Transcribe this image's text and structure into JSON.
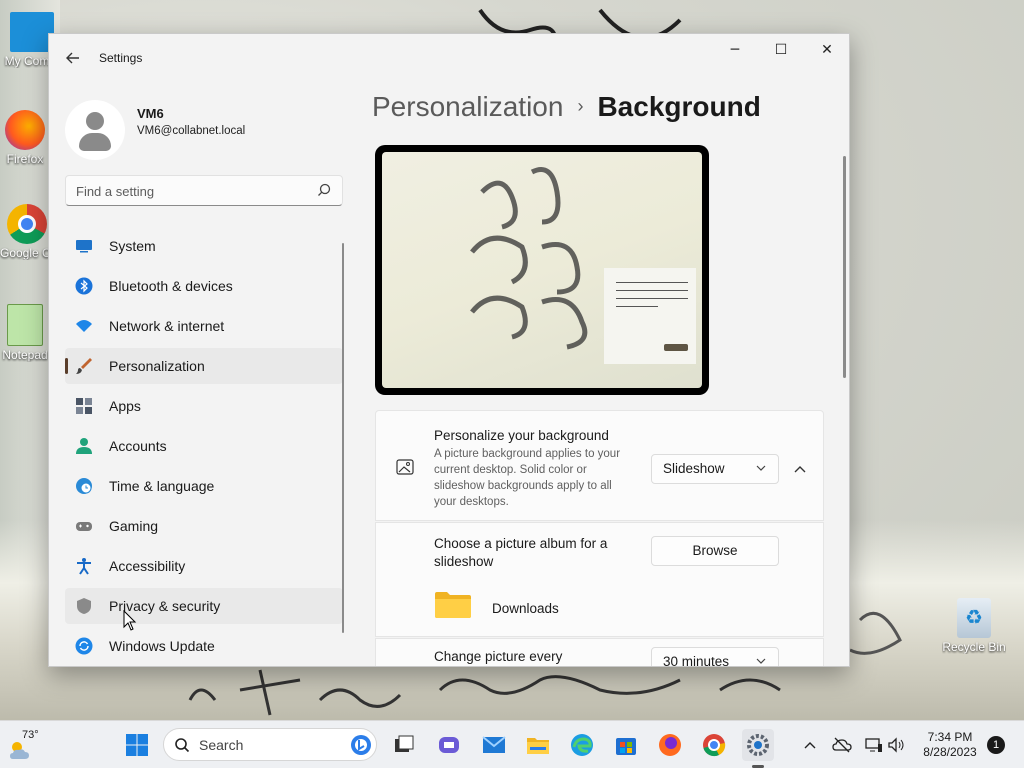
{
  "desktop": {
    "icons": [
      {
        "label": "My Com..."
      },
      {
        "label": "Firefox"
      },
      {
        "label": "Google Chrome"
      },
      {
        "label": "Notepad"
      },
      {
        "label": "Recycle Bin"
      }
    ]
  },
  "window": {
    "app_title": "Settings",
    "controls": {
      "minimize": "─",
      "maximize": "☐",
      "close": "✕"
    }
  },
  "account": {
    "name": "VM6",
    "email": "VM6@collabnet.local"
  },
  "search": {
    "placeholder": "Find a setting"
  },
  "nav": {
    "items": [
      {
        "label": "System",
        "icon": "monitor-icon",
        "color": "#1e73c9"
      },
      {
        "label": "Bluetooth & devices",
        "icon": "bluetooth-icon",
        "color": "#1a73d9"
      },
      {
        "label": "Network & internet",
        "icon": "wifi-icon",
        "color": "#1e86e8"
      },
      {
        "label": "Personalization",
        "icon": "brush-icon",
        "color": "#c0642f",
        "selected": true
      },
      {
        "label": "Apps",
        "icon": "apps-icon",
        "color": "#4a5565"
      },
      {
        "label": "Accounts",
        "icon": "person-icon",
        "color": "#1fa37b"
      },
      {
        "label": "Time & language",
        "icon": "globe-clock-icon",
        "color": "#2a8ad6"
      },
      {
        "label": "Gaming",
        "icon": "gamepad-icon",
        "color": "#7a7a7a"
      },
      {
        "label": "Accessibility",
        "icon": "accessibility-icon",
        "color": "#1769c7"
      },
      {
        "label": "Privacy & security",
        "icon": "shield-icon",
        "color": "#8a8a8a",
        "hover": true
      },
      {
        "label": "Windows Update",
        "icon": "update-icon",
        "color": "#1e86e8"
      }
    ]
  },
  "breadcrumb": {
    "parent": "Personalization",
    "separator": "›",
    "current": "Background"
  },
  "background": {
    "personalize": {
      "title": "Personalize your background",
      "description": "A picture background applies to your current desktop. Solid color or slideshow backgrounds apply to all your desktops.",
      "value": "Slideshow"
    },
    "album": {
      "title": "Choose a picture album for a slideshow",
      "button": "Browse",
      "folder": "Downloads"
    },
    "interval": {
      "title": "Change picture every",
      "value": "30 minutes"
    }
  },
  "taskbar": {
    "weather_temp": "73°",
    "search_label": "Search",
    "clock_time": "7:34 PM",
    "clock_date": "8/28/2023",
    "notification_count": "1"
  }
}
